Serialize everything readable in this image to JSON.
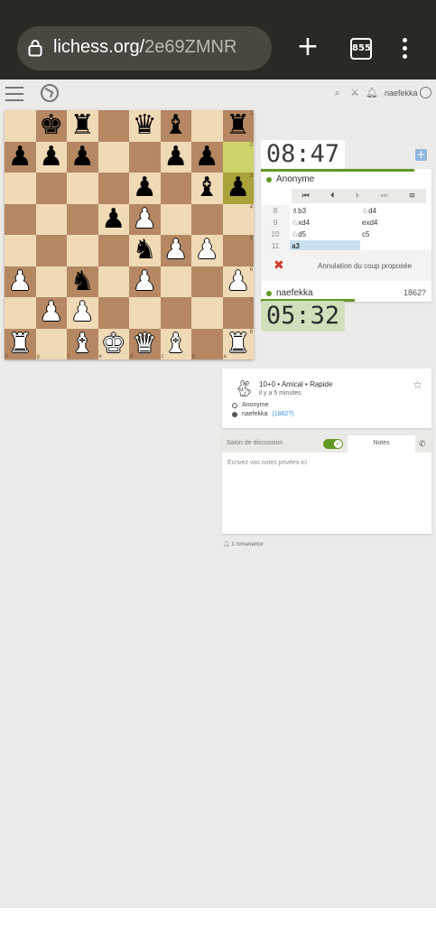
{
  "browser": {
    "url_domain": "lichess.org/",
    "url_path": "2e69ZMNR",
    "tab_count": "855"
  },
  "nav": {
    "username": "naefekka",
    "icons": [
      "hamburger-icon",
      "lichess-logo",
      "search-icon",
      "swords-icon",
      "bell-icon",
      "user-icon"
    ]
  },
  "board": {
    "ranks": [
      [
        "",
        "bK",
        "bR",
        "",
        "bQ",
        "bB",
        "",
        "bR"
      ],
      [
        "bP",
        "bP",
        "bP",
        "",
        "",
        "bP",
        "bP",
        ""
      ],
      [
        "",
        "",
        "",
        "",
        "bP",
        "",
        "bB",
        "bP"
      ],
      [
        "",
        "",
        "",
        "bP",
        "wP",
        "",
        "",
        ""
      ],
      [
        "",
        "",
        "",
        "",
        "bN",
        "wP",
        "wP",
        ""
      ],
      [
        "wP",
        "",
        "bN",
        "",
        "wP",
        "",
        "",
        "wP"
      ],
      [
        "",
        "wP",
        "wP",
        "",
        "",
        "",
        "",
        ""
      ],
      [
        "wR",
        "",
        "wB",
        "wK",
        "wQ",
        "wB",
        "",
        "wR"
      ]
    ],
    "last_move_squares": [
      "1-7",
      "2-7"
    ],
    "rank_labels": [
      "1",
      "2",
      "3",
      "4",
      "5",
      "6",
      "7",
      "8"
    ],
    "file_labels": [
      "h",
      "g",
      "f",
      "e",
      "d",
      "c",
      "b",
      "a"
    ]
  },
  "clocks": {
    "top_minutes": "08",
    "top_seconds": "47",
    "bottom_minutes": "05",
    "bottom_seconds": "32",
    "top_bar_fraction": 0.9,
    "bottom_bar_fraction": 0.55
  },
  "players": {
    "top_name": "Anonyme",
    "bottom_name": "naefekka",
    "bottom_rating": "1862?"
  },
  "moves": [
    {
      "num": "8",
      "white": "♗b3",
      "black": "♘d4"
    },
    {
      "num": "9",
      "white": "♘xd4",
      "black": "exd4"
    },
    {
      "num": "10",
      "white": "♘d5",
      "black": "c5"
    },
    {
      "num": "11",
      "white": "a3",
      "black": ""
    }
  ],
  "takeback": {
    "decline_symbol": "✖",
    "text": "Annulation du coup proposée"
  },
  "game_info": {
    "setup": "10+0 • Amical • Rapide",
    "ago": "il y a 5 minutes",
    "white_player": "Anonyme",
    "black_player": "naefekka",
    "black_rating": "(1862?)"
  },
  "chat": {
    "chat_tab": "Salon de discussion",
    "notes_tab": "Notes",
    "notes_placeholder": "Écrivez vos notes privées ici"
  },
  "watchers": {
    "count": "1",
    "name": "romanamor"
  },
  "colors": {
    "light_square": "#f0d9b5",
    "dark_square": "#b58863",
    "accent_green": "#629924",
    "chrome": "#2b2924"
  }
}
